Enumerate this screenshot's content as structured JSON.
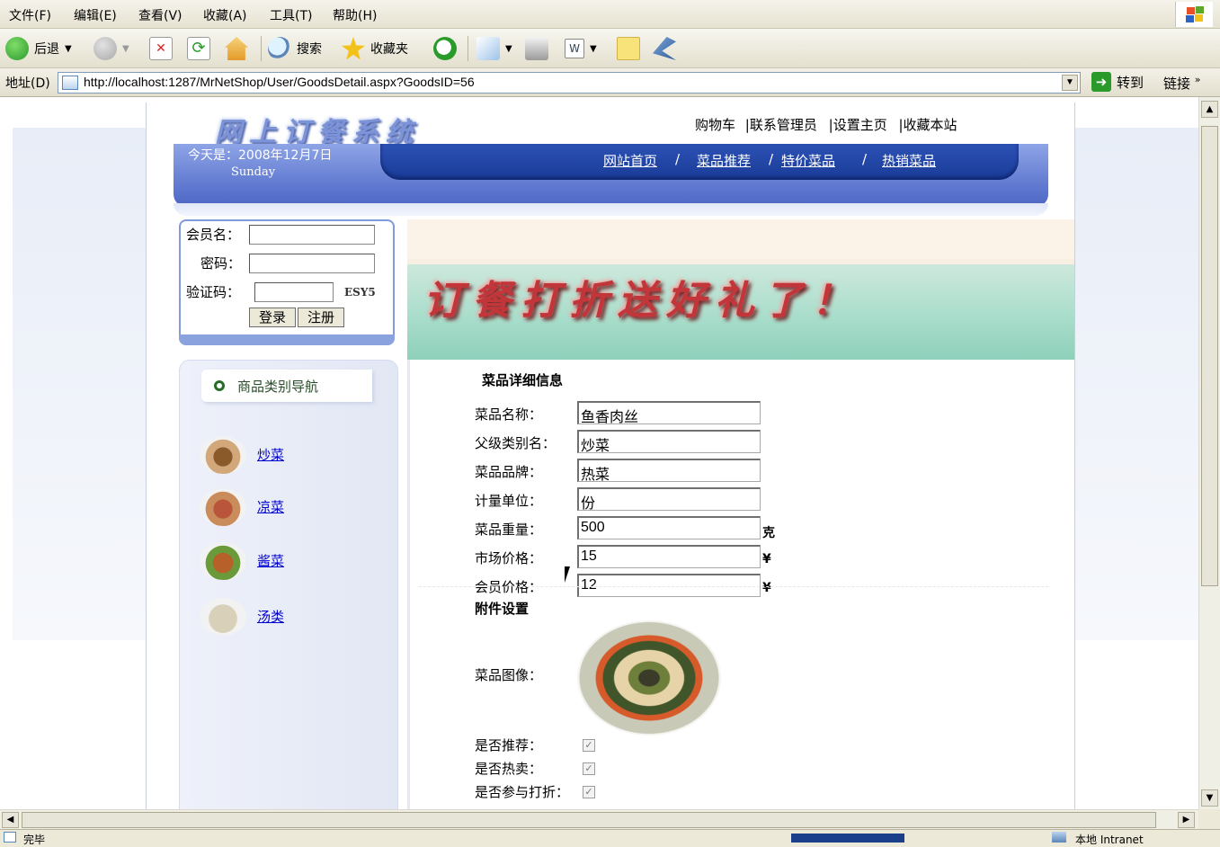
{
  "menubar": {
    "items": [
      "文件(F)",
      "编辑(E)",
      "查看(V)",
      "收藏(A)",
      "工具(T)",
      "帮助(H)"
    ]
  },
  "toolbar": {
    "back_label": "后退",
    "search_label": "搜索",
    "favorites_label": "收藏夹"
  },
  "addressbar": {
    "label": "地址(D)",
    "url": "http://localhost:1287/MrNetShop/User/GoodsDetail.aspx?GoodsID=56",
    "go_label": "转到",
    "links_label": "链接"
  },
  "header": {
    "site_title": "网上订餐系统",
    "top_links": [
      "购物车",
      "|联系管理员",
      "|设置主页",
      "|收藏本站"
    ],
    "date_text": "今天是：2008年12月7日",
    "weekday": "Sunday",
    "nav": [
      "网站首页",
      "菜品推荐",
      "特价菜品",
      "热销菜品"
    ],
    "nav_sep": "/"
  },
  "login": {
    "member_label": "会员名：",
    "password_label": "密码：",
    "captcha_label": "验证码：",
    "captcha_code": "ESY5",
    "login_btn": "登录",
    "register_btn": "注册"
  },
  "category": {
    "title": "商品类别导航",
    "items": [
      "炒菜",
      "凉菜",
      "酱菜",
      "汤类"
    ]
  },
  "banner": {
    "text": "订餐打折送好礼了！"
  },
  "detail": {
    "section_title": "菜品详细信息",
    "fields": [
      {
        "label": "菜品名称：",
        "value": "鱼香肉丝",
        "unit": ""
      },
      {
        "label": "父级类别名：",
        "value": "炒菜",
        "unit": ""
      },
      {
        "label": "菜品品牌：",
        "value": "热菜",
        "unit": ""
      },
      {
        "label": "计量单位：",
        "value": "份",
        "unit": ""
      },
      {
        "label": "菜品重量：",
        "value": "500",
        "unit": "克"
      },
      {
        "label": "市场价格：",
        "value": "15",
        "unit": "¥"
      },
      {
        "label": "会员价格：",
        "value": "12",
        "unit": "¥"
      }
    ],
    "attach_title": "附件设置",
    "image_label": "菜品图像：",
    "checks": [
      {
        "label": "是否推荐：",
        "checked": true
      },
      {
        "label": "是否热卖：",
        "checked": true
      },
      {
        "label": "是否参与打折：",
        "checked": true
      }
    ]
  },
  "status": {
    "left": "完毕",
    "zone": "本地 Intranet"
  }
}
